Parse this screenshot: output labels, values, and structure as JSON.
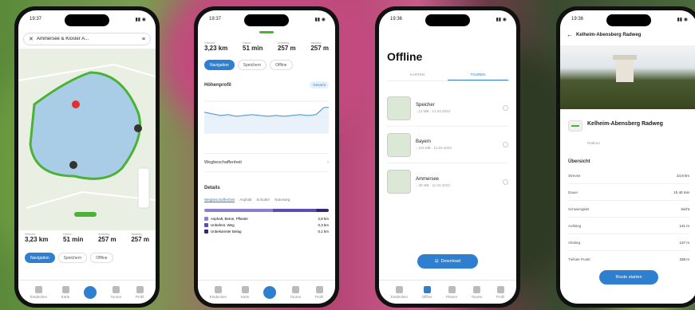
{
  "phone1": {
    "status_time": "19:37",
    "header_title": "Ammersee & Kloster A...",
    "stats": [
      {
        "label": "Strecke",
        "value": "3,23 km"
      },
      {
        "label": "Dauer",
        "value": "51 min"
      },
      {
        "label": "Aufstieg",
        "value": "257 m"
      },
      {
        "label": "Abstieg",
        "value": "257 m"
      }
    ],
    "buttons": [
      "Navigation",
      "Speichern",
      "Offline"
    ],
    "tabs": [
      "Entdecken",
      "Karte",
      "Planen",
      "Touren",
      "Profil"
    ]
  },
  "phone2": {
    "status_time": "19:37",
    "stats": [
      {
        "label": "Strecke",
        "value": "3,23 km"
      },
      {
        "label": "Dauer",
        "value": "51 min"
      },
      {
        "label": "Aufstieg",
        "value": "257 m"
      },
      {
        "label": "Abstieg",
        "value": "257 m"
      }
    ],
    "buttons": [
      "Navigation",
      "Speichern",
      "Offline"
    ],
    "elevation_title": "Höhenprofil",
    "elevation_badge": "Gesamt",
    "wegbeschaffenheit": "Wegbeschaffenheit",
    "details_title": "Details",
    "details_tabs": [
      "Wegbeschaffenheit",
      "Asphalt",
      "Schotter",
      "Naturweg"
    ],
    "legend": [
      {
        "label": "Asphalt, Beton, Pflaster",
        "value": "2,8 km",
        "color": "#8b7fd0"
      },
      {
        "label": "Unbefest. Weg",
        "value": "0,3 km",
        "color": "#5a4fb0"
      },
      {
        "label": "Unbekannter Belag",
        "value": "0,1 km",
        "color": "#2f2a70"
      }
    ],
    "tabs": [
      "Entdecken",
      "Karte",
      "Planen",
      "Touren",
      "Profil"
    ]
  },
  "phone3": {
    "status_time": "19:36",
    "title": "Offline",
    "segment_tabs": [
      "KARTEN",
      "TOUREN"
    ],
    "items": [
      {
        "name": "Speicher",
        "meta": "↓ 12 MB · 12.04.2023"
      },
      {
        "name": "Bayern",
        "meta": "↓ 115 MB · 11.04.2023"
      },
      {
        "name": "Ammersee",
        "meta": "↓ 35 MB · 11.04.2023"
      }
    ],
    "download_button": "Download",
    "tabs": [
      "Entdecken",
      "Offline",
      "Planen",
      "Touren",
      "Profil"
    ]
  },
  "phone4": {
    "status_time": "19:36",
    "header_title": "Kelheim-Abensberg Radweg",
    "card_title": "Kelheim-Abensberg Radweg",
    "card_sub": "Radtour",
    "overview_title": "Übersicht",
    "rows": [
      {
        "label": "Strecke",
        "value": "24,9 km"
      },
      {
        "label": "Dauer",
        "value": "1h 40 min"
      },
      {
        "label": "Schwierigkeit",
        "value": "leicht"
      },
      {
        "label": "Aufstieg",
        "value": "141 m"
      },
      {
        "label": "Abstieg",
        "value": "137 m"
      },
      {
        "label": "Tiefster Punkt",
        "value": "338 m"
      }
    ],
    "cta": "Route starten"
  }
}
